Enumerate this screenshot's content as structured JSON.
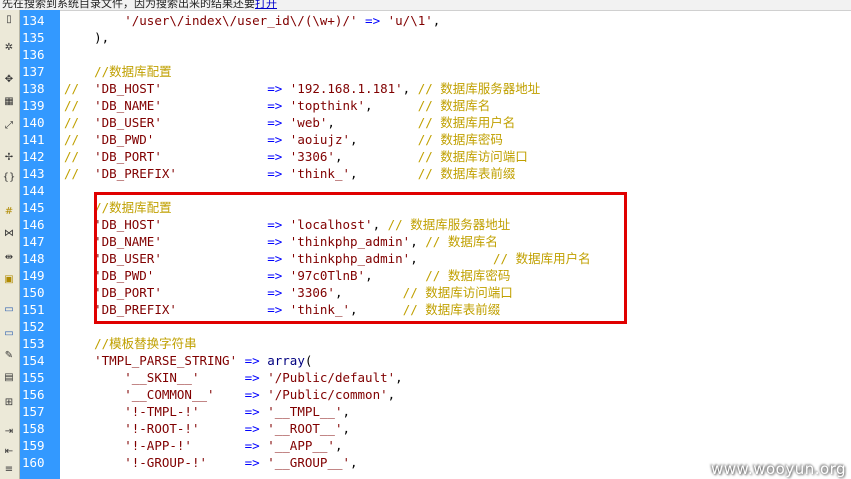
{
  "topbar": {
    "text": "先在搜索到系统目录文件，因为搜索出来的结果还要",
    "link": "打开"
  },
  "watermark": "www.wooyun.org",
  "lines": [
    {
      "num": "134",
      "segs": [
        {
          "t": "        ",
          "c": "txt"
        },
        {
          "t": "'/user\\/index\\/user_id\\/(\\w+)/'",
          "c": "str"
        },
        {
          "t": " => ",
          "c": "op"
        },
        {
          "t": "'u/\\1'",
          "c": "str"
        },
        {
          "t": ",",
          "c": "txt"
        }
      ]
    },
    {
      "num": "135",
      "segs": [
        {
          "t": "    ),",
          "c": "txt"
        }
      ]
    },
    {
      "num": "136",
      "segs": []
    },
    {
      "num": "137",
      "segs": [
        {
          "t": "    //数据库配置",
          "c": "cmt"
        }
      ]
    },
    {
      "num": "138",
      "segs": [
        {
          "t": "//  ",
          "c": "cmt"
        },
        {
          "t": "'DB_HOST'",
          "c": "str"
        },
        {
          "t": "              ",
          "c": "txt"
        },
        {
          "t": "=> ",
          "c": "op"
        },
        {
          "t": "'192.168.1.181'",
          "c": "str"
        },
        {
          "t": ", ",
          "c": "txt"
        },
        {
          "t": "// 数据库服务器地址",
          "c": "cmt"
        }
      ]
    },
    {
      "num": "139",
      "segs": [
        {
          "t": "//  ",
          "c": "cmt"
        },
        {
          "t": "'DB_NAME'",
          "c": "str"
        },
        {
          "t": "              ",
          "c": "txt"
        },
        {
          "t": "=> ",
          "c": "op"
        },
        {
          "t": "'topthink'",
          "c": "str"
        },
        {
          "t": ",      ",
          "c": "txt"
        },
        {
          "t": "// 数据库名",
          "c": "cmt"
        }
      ]
    },
    {
      "num": "140",
      "segs": [
        {
          "t": "//  ",
          "c": "cmt"
        },
        {
          "t": "'DB_USER'",
          "c": "str"
        },
        {
          "t": "              ",
          "c": "txt"
        },
        {
          "t": "=> ",
          "c": "op"
        },
        {
          "t": "'web'",
          "c": "str"
        },
        {
          "t": ",           ",
          "c": "txt"
        },
        {
          "t": "// 数据库用户名",
          "c": "cmt"
        }
      ]
    },
    {
      "num": "141",
      "segs": [
        {
          "t": "//  ",
          "c": "cmt"
        },
        {
          "t": "'DB_PWD'",
          "c": "str"
        },
        {
          "t": "               ",
          "c": "txt"
        },
        {
          "t": "=> ",
          "c": "op"
        },
        {
          "t": "'aoiujz'",
          "c": "str"
        },
        {
          "t": ",        ",
          "c": "txt"
        },
        {
          "t": "// 数据库密码",
          "c": "cmt"
        }
      ]
    },
    {
      "num": "142",
      "segs": [
        {
          "t": "//  ",
          "c": "cmt"
        },
        {
          "t": "'DB_PORT'",
          "c": "str"
        },
        {
          "t": "              ",
          "c": "txt"
        },
        {
          "t": "=> ",
          "c": "op"
        },
        {
          "t": "'3306'",
          "c": "str"
        },
        {
          "t": ",          ",
          "c": "txt"
        },
        {
          "t": "// 数据库访问端口",
          "c": "cmt"
        }
      ]
    },
    {
      "num": "143",
      "segs": [
        {
          "t": "//  ",
          "c": "cmt"
        },
        {
          "t": "'DB_PREFIX'",
          "c": "str"
        },
        {
          "t": "            ",
          "c": "txt"
        },
        {
          "t": "=> ",
          "c": "op"
        },
        {
          "t": "'think_'",
          "c": "str"
        },
        {
          "t": ",        ",
          "c": "txt"
        },
        {
          "t": "// 数据库表前缀",
          "c": "cmt"
        }
      ]
    },
    {
      "num": "144",
      "segs": []
    },
    {
      "num": "145",
      "segs": [
        {
          "t": "    //数据库配置",
          "c": "cmt"
        }
      ]
    },
    {
      "num": "146",
      "segs": [
        {
          "t": "    ",
          "c": "txt"
        },
        {
          "t": "'DB_HOST'",
          "c": "str"
        },
        {
          "t": "              ",
          "c": "txt"
        },
        {
          "t": "=> ",
          "c": "op"
        },
        {
          "t": "'localhost'",
          "c": "str"
        },
        {
          "t": ", ",
          "c": "txt"
        },
        {
          "t": "// 数据库服务器地址",
          "c": "cmt"
        }
      ]
    },
    {
      "num": "147",
      "segs": [
        {
          "t": "    ",
          "c": "txt"
        },
        {
          "t": "'DB_NAME'",
          "c": "str"
        },
        {
          "t": "              ",
          "c": "txt"
        },
        {
          "t": "=> ",
          "c": "op"
        },
        {
          "t": "'thinkphp_admin'",
          "c": "str"
        },
        {
          "t": ", ",
          "c": "txt"
        },
        {
          "t": "// 数据库名",
          "c": "cmt"
        }
      ]
    },
    {
      "num": "148",
      "segs": [
        {
          "t": "    ",
          "c": "txt"
        },
        {
          "t": "'DB_USER'",
          "c": "str"
        },
        {
          "t": "              ",
          "c": "txt"
        },
        {
          "t": "=> ",
          "c": "op"
        },
        {
          "t": "'thinkphp_admin'",
          "c": "str"
        },
        {
          "t": ",          ",
          "c": "txt"
        },
        {
          "t": "// 数据库用户名",
          "c": "cmt"
        }
      ]
    },
    {
      "num": "149",
      "segs": [
        {
          "t": "    ",
          "c": "txt"
        },
        {
          "t": "'DB_PWD'",
          "c": "str"
        },
        {
          "t": "               ",
          "c": "txt"
        },
        {
          "t": "=> ",
          "c": "op"
        },
        {
          "t": "'97c0TlnB'",
          "c": "str"
        },
        {
          "t": ",       ",
          "c": "txt"
        },
        {
          "t": "// 数据库密码",
          "c": "cmt"
        }
      ]
    },
    {
      "num": "150",
      "segs": [
        {
          "t": "    ",
          "c": "txt"
        },
        {
          "t": "'DB_PORT'",
          "c": "str"
        },
        {
          "t": "              ",
          "c": "txt"
        },
        {
          "t": "=> ",
          "c": "op"
        },
        {
          "t": "'3306'",
          "c": "str"
        },
        {
          "t": ",        ",
          "c": "txt"
        },
        {
          "t": "// 数据库访问端口",
          "c": "cmt"
        }
      ]
    },
    {
      "num": "151",
      "segs": [
        {
          "t": "    ",
          "c": "txt"
        },
        {
          "t": "'DB_PREFIX'",
          "c": "str"
        },
        {
          "t": "            ",
          "c": "txt"
        },
        {
          "t": "=> ",
          "c": "op"
        },
        {
          "t": "'think_'",
          "c": "str"
        },
        {
          "t": ",      ",
          "c": "txt"
        },
        {
          "t": "// 数据库表前缀",
          "c": "cmt"
        }
      ]
    },
    {
      "num": "152",
      "segs": []
    },
    {
      "num": "153",
      "segs": [
        {
          "t": "    //模板替换字符串",
          "c": "cmt"
        }
      ]
    },
    {
      "num": "154",
      "segs": [
        {
          "t": "    ",
          "c": "txt"
        },
        {
          "t": "'TMPL_PARSE_STRING'",
          "c": "str"
        },
        {
          "t": " => ",
          "c": "op"
        },
        {
          "t": "array",
          "c": "kw"
        },
        {
          "t": "(",
          "c": "txt"
        }
      ]
    },
    {
      "num": "155",
      "segs": [
        {
          "t": "        ",
          "c": "txt"
        },
        {
          "t": "'__SKIN__'",
          "c": "str"
        },
        {
          "t": "      ",
          "c": "txt"
        },
        {
          "t": "=> ",
          "c": "op"
        },
        {
          "t": "'/Public/default'",
          "c": "str"
        },
        {
          "t": ",",
          "c": "txt"
        }
      ]
    },
    {
      "num": "156",
      "segs": [
        {
          "t": "        ",
          "c": "txt"
        },
        {
          "t": "'__COMMON__'",
          "c": "str"
        },
        {
          "t": "    ",
          "c": "txt"
        },
        {
          "t": "=> ",
          "c": "op"
        },
        {
          "t": "'/Public/common'",
          "c": "str"
        },
        {
          "t": ",",
          "c": "txt"
        }
      ]
    },
    {
      "num": "157",
      "segs": [
        {
          "t": "        ",
          "c": "txt"
        },
        {
          "t": "'!-TMPL-!'",
          "c": "str"
        },
        {
          "t": "      ",
          "c": "txt"
        },
        {
          "t": "=> ",
          "c": "op"
        },
        {
          "t": "'__TMPL__'",
          "c": "str"
        },
        {
          "t": ",",
          "c": "txt"
        }
      ]
    },
    {
      "num": "158",
      "segs": [
        {
          "t": "        ",
          "c": "txt"
        },
        {
          "t": "'!-ROOT-!'",
          "c": "str"
        },
        {
          "t": "      ",
          "c": "txt"
        },
        {
          "t": "=> ",
          "c": "op"
        },
        {
          "t": "'__ROOT__'",
          "c": "str"
        },
        {
          "t": ",",
          "c": "txt"
        }
      ]
    },
    {
      "num": "159",
      "segs": [
        {
          "t": "        ",
          "c": "txt"
        },
        {
          "t": "'!-APP-!'",
          "c": "str"
        },
        {
          "t": "       ",
          "c": "txt"
        },
        {
          "t": "=> ",
          "c": "op"
        },
        {
          "t": "'__APP__'",
          "c": "str"
        },
        {
          "t": ",",
          "c": "txt"
        }
      ]
    },
    {
      "num": "160",
      "segs": [
        {
          "t": "        ",
          "c": "txt"
        },
        {
          "t": "'!-GROUP-!'",
          "c": "str"
        },
        {
          "t": "     ",
          "c": "txt"
        },
        {
          "t": "=> ",
          "c": "op"
        },
        {
          "t": "'__GROUP__'",
          "c": "str"
        },
        {
          "t": ",",
          "c": "txt"
        }
      ]
    }
  ],
  "toolbar_icons": [
    "new-file-icon",
    "gear-icon",
    "move-icon",
    "select-icon",
    "expand-icon",
    "collapse-icon",
    "braces-icon",
    "hash-icon",
    "wrap-icon",
    "split-icon",
    "image-icon",
    "comment-icon",
    "comment-add-icon",
    "edit-icon",
    "document-icon",
    "table-icon",
    "indent-icon",
    "outdent-icon",
    "list-icon"
  ]
}
